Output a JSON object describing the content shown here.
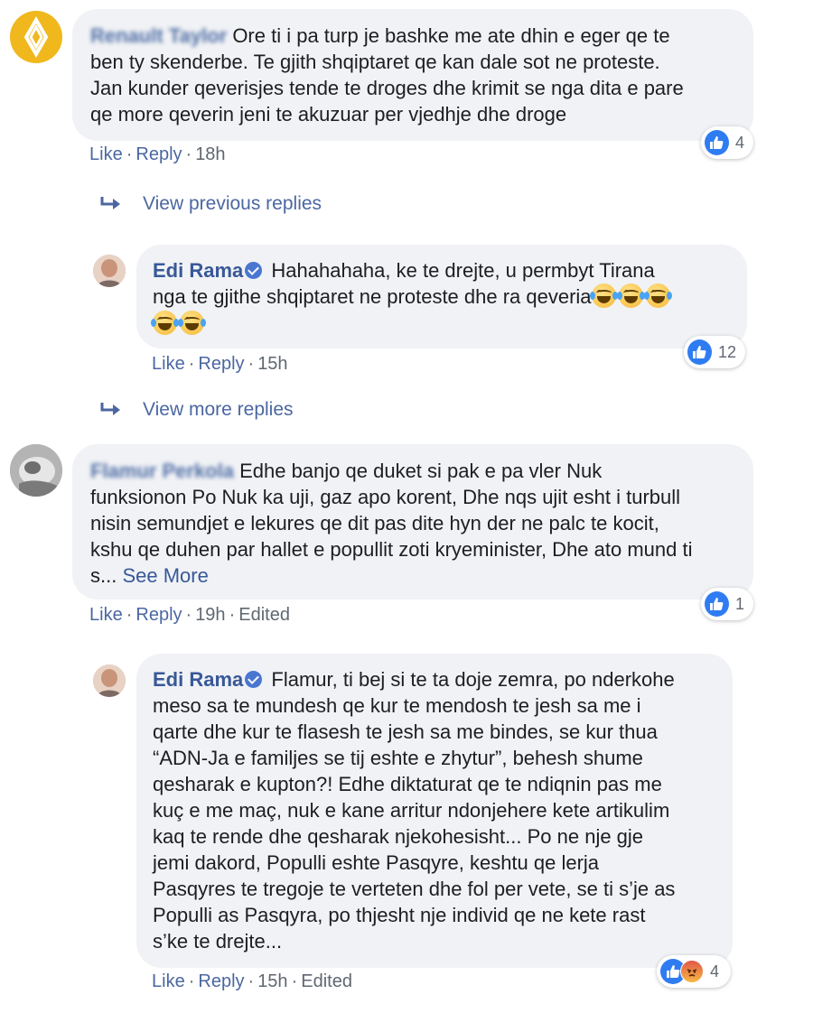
{
  "comments": [
    {
      "author": "Renault Taylor",
      "text": "Ore ti i pa turp je bashke me ate dhin e eger qe te\nben ty skenderbe. Te gjith shqiptaret qe kan dale sot ne proteste.\nJan kunder qeverisjes tende te droges dhe krimit se nga dita e pare\nqe more qeverin jeni te akuzuar per vjedhje dhe droge",
      "meta": {
        "like": "Like",
        "reply": "Reply",
        "time": "18h"
      },
      "reaction_count": "4"
    },
    {
      "author": "Edi Rama",
      "text": "Hahahahaha, ke te drejte, u permbyt Tirana\nnga te gjithe shqiptaret ne proteste dhe ra qeveria",
      "meta": {
        "like": "Like",
        "reply": "Reply",
        "time": "15h"
      },
      "reaction_count": "12"
    },
    {
      "author": "Flamur Perkola",
      "text": "Edhe banjo qe duket si pak e pa vler Nuk\nfunksionon Po Nuk ka uji, gaz apo korent, Dhe nqs ujit esht i turbull\nnisin semundjet e lekures qe dit pas dite hyn der ne palc te kocit,\nkshu qe duhen par hallet e popullit zoti kryeminister, Dhe ato mund ti\ns...",
      "see_more": "See More",
      "meta": {
        "like": "Like",
        "reply": "Reply",
        "time": "19h",
        "edited": "Edited"
      },
      "reaction_count": "1"
    },
    {
      "author": "Edi Rama",
      "text": "Flamur, ti bej si te ta doje zemra, po nderkohe\nmeso sa te mundesh qe kur te mendosh te jesh sa me i\nqarte dhe kur te flasesh te jesh sa me bindes, se kur thua\n“ADN-Ja e familjes se tij eshte e zhytur”, behesh shume\nqesharak e kupton?! Edhe diktaturat qe te ndiqnin pas me\nkuç e me maç, nuk e kane arritur ndonjehere kete artikulim\nkaq te rende dhe qesharak njekohesisht... Po ne nje gje\njemi dakord, Populli eshte Pasqyre, keshtu qe lerja\nPasqyres te tregoje te verteten dhe fol per vete, se ti s’je as\nPopulli as Pasqyra, po thjesht nje individ qe ne kete rast\ns’ke te drejte...",
      "meta": {
        "like": "Like",
        "reply": "Reply",
        "time": "15h",
        "edited": "Edited"
      },
      "reaction_count": "4"
    }
  ],
  "view_previous_replies": "View previous replies",
  "view_more_replies": "View more replies",
  "separator": "·",
  "colors": {
    "link": "#4b67a1",
    "author": "#385898",
    "bubble": "#f0f2f5",
    "like_blue": "#2f7cf2"
  }
}
